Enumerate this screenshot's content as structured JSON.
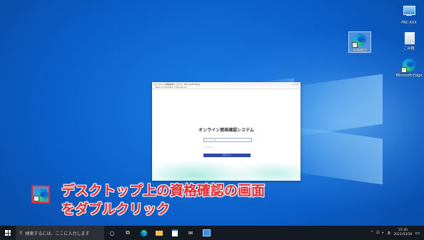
{
  "desktop": {
    "icons": [
      {
        "label": "資格確認",
        "icon": "edge-shortcut-icon",
        "selected": true
      },
      {
        "label": "PRC-XXX",
        "icon": "this-pc-icon"
      },
      {
        "label": "ごみ箱",
        "icon": "recycle-bin-icon"
      },
      {
        "label": "Microsoft Edge",
        "icon": "edge-icon"
      }
    ]
  },
  "browser": {
    "tab_title": "オンライン資格確認システム - Microsoft Edge",
    "address": "https://onshikaku.mhlw.go.jp/...",
    "app_title": "オンライン資格確認システム",
    "user_placeholder": "ユーザーID",
    "password_hint": "パスワード",
    "login_button": "ログイン"
  },
  "annotation": {
    "line1": "デスクトップ上の資格確認の画面",
    "line2": "をダブルクリック",
    "accent_color": "#e8262b"
  },
  "taskbar": {
    "search_placeholder": "検索するには、ここに入力します",
    "ime": "あ",
    "time": "15:30",
    "date": "2021/03/30"
  }
}
